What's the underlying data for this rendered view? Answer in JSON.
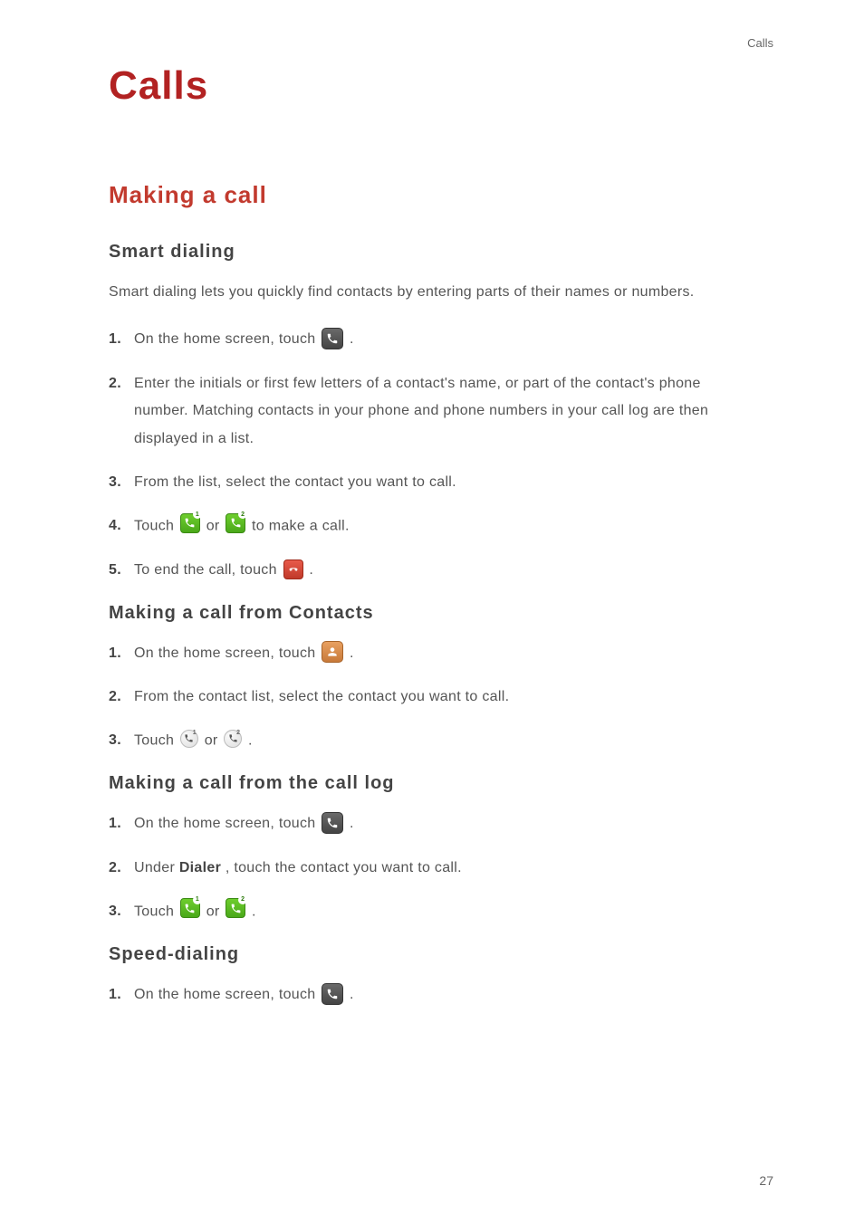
{
  "header": {
    "label": "Calls"
  },
  "title": "Calls",
  "section1": {
    "title": "Making a call",
    "sub1": {
      "title": "Smart  dialing",
      "intro": "Smart dialing lets you quickly find contacts by entering parts of their names or numbers.",
      "steps": {
        "s1": {
          "num": "1.",
          "a": "On the home screen, touch ",
          "b": " ."
        },
        "s2": {
          "num": "2.",
          "text": "Enter the initials or first few letters of a contact's name, or part of the contact's phone number. Matching contacts in your phone and phone numbers in your call log are then displayed in a list."
        },
        "s3": {
          "num": "3.",
          "text": "From the list, select the contact you want to call."
        },
        "s4": {
          "num": "4.",
          "a": "Touch ",
          "b": " or ",
          "c": " to make a call."
        },
        "s5": {
          "num": "5.",
          "a": "To end the call, touch ",
          "b": " ."
        }
      }
    },
    "sub2": {
      "title": "Making  a  call  from  Contacts",
      "steps": {
        "s1": {
          "num": "1.",
          "a": "On the home screen, touch ",
          "b": " ."
        },
        "s2": {
          "num": "2.",
          "text": "From the contact list, select the contact you want to call."
        },
        "s3": {
          "num": "3.",
          "a": "Touch ",
          "b": " or ",
          "c": " ."
        }
      }
    },
    "sub3": {
      "title": "Making  a  call  from  the  call  log",
      "steps": {
        "s1": {
          "num": "1.",
          "a": "On the home screen, touch ",
          "b": " ."
        },
        "s2": {
          "num": "2.",
          "a": "Under ",
          "bold": "Dialer",
          "b": ", touch the contact you want to call."
        },
        "s3": {
          "num": "3.",
          "a": "Touch ",
          "b": " or ",
          "c": " ."
        }
      }
    },
    "sub4": {
      "title": "Speed-dialing",
      "steps": {
        "s1": {
          "num": "1.",
          "a": "On the home screen, touch ",
          "b": " ."
        }
      }
    }
  },
  "pagenum": "27",
  "icons": {
    "badge1": "1",
    "badge2": "2"
  }
}
